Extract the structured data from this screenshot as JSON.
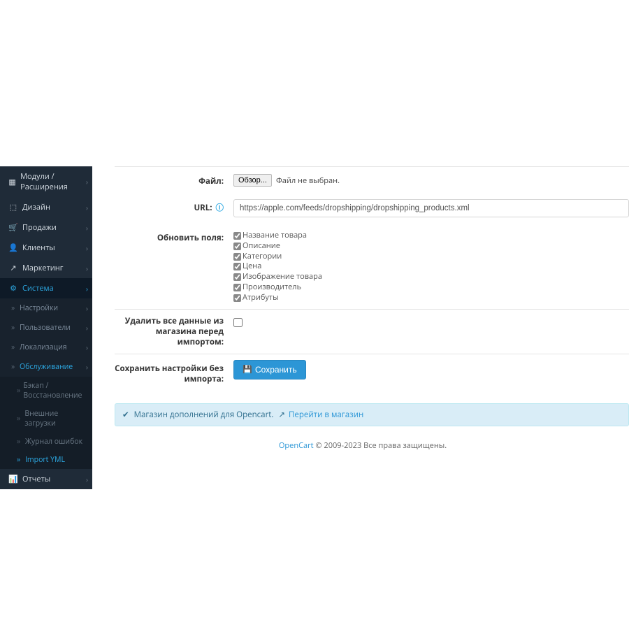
{
  "sidebar": {
    "items": [
      {
        "icon": "▦",
        "label": "Модули / Расширения",
        "hasSub": true
      },
      {
        "icon": "⬚",
        "label": "Дизайн",
        "hasSub": true
      },
      {
        "icon": "🛒",
        "label": "Продажи",
        "hasSub": true
      },
      {
        "icon": "👤",
        "label": "Клиенты",
        "hasSub": true
      },
      {
        "icon": "↗",
        "label": "Маркетинг",
        "hasSub": true
      },
      {
        "icon": "⚙",
        "label": "Система",
        "hasSub": true,
        "active": true
      },
      {
        "icon": "📊",
        "label": "Отчеты",
        "hasSub": true
      }
    ],
    "system_sub": [
      {
        "label": "Настройки",
        "hasSub": true
      },
      {
        "label": "Пользователи",
        "hasSub": true
      },
      {
        "label": "Локализация",
        "hasSub": true
      },
      {
        "label": "Обслуживание",
        "hasSub": true,
        "active": true
      }
    ],
    "service_sub": [
      {
        "label": "Бэкап / Восстановление"
      },
      {
        "label": "Внешние загрузки"
      },
      {
        "label": "Журнал ошибок"
      },
      {
        "label": "Import YML",
        "active": true
      }
    ]
  },
  "form": {
    "file_label": "Файл:",
    "file_btn": "Обзор...",
    "file_status": "Файл не выбран.",
    "url_label": "URL:",
    "url_value": "https://apple.com/feeds/dropshipping/dropshipping_products.xml",
    "update_label": "Обновить поля:",
    "fields": [
      {
        "label": "Название товара",
        "checked": true
      },
      {
        "label": "Описание",
        "checked": true
      },
      {
        "label": "Категории",
        "checked": true
      },
      {
        "label": "Цена",
        "checked": true
      },
      {
        "label": "Изображение товара",
        "checked": true
      },
      {
        "label": "Производитель",
        "checked": true
      },
      {
        "label": "Атрибуты",
        "checked": true
      }
    ],
    "wipe_label": "Удалить все данные из магазина перед импортом:",
    "wipe_checked": false,
    "save_label": "Сохранить настройки без импорта:",
    "save_btn": "Сохранить"
  },
  "alert": {
    "text": "Магазин дополнений для Opencart.",
    "link": "Перейти в магазин"
  },
  "footer": {
    "brand": "OpenCart",
    "rest": " © 2009-2023 Все права защищены."
  }
}
